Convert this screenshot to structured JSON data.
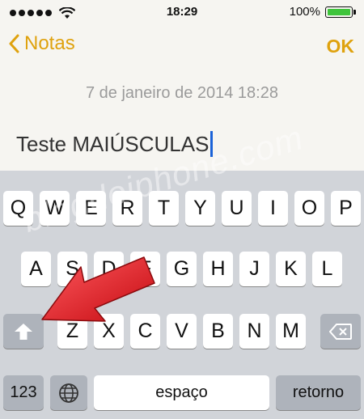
{
  "status": {
    "time": "18:29",
    "battery": "100%"
  },
  "nav": {
    "back_label": "Notas",
    "ok_label": "OK"
  },
  "note": {
    "date": "7 de janeiro de 2014 18:28",
    "text": "Teste MAIÚSCULAS"
  },
  "watermark": "blogdoiphone.com",
  "keyboard": {
    "row1": [
      "Q",
      "W",
      "E",
      "R",
      "T",
      "Y",
      "U",
      "I",
      "O",
      "P"
    ],
    "row2": [
      "A",
      "S",
      "D",
      "F",
      "G",
      "H",
      "J",
      "K",
      "L"
    ],
    "row3": [
      "Z",
      "X",
      "C",
      "V",
      "B",
      "N",
      "M"
    ],
    "numbers_label": "123",
    "space_label": "espaço",
    "return_label": "retorno"
  },
  "colors": {
    "accent": "#dfa20e",
    "caret": "#1a62d8",
    "arrow": "#e8141b",
    "battery": "#3ec43b"
  }
}
